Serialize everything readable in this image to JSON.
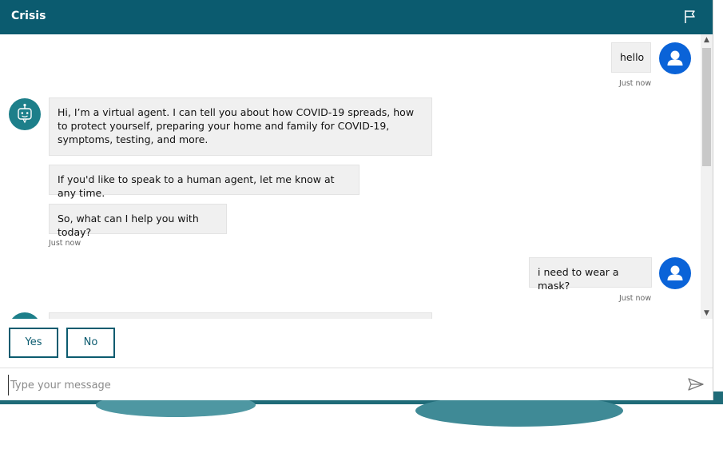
{
  "header": {
    "title": "Crisis",
    "icon": "flag-icon"
  },
  "messages": [
    {
      "from": "user",
      "text": "hello",
      "time": "Just now"
    },
    {
      "from": "bot",
      "text": "Hi, I’m a virtual agent. I can tell you about how COVID-19 spreads, how to protect yourself, preparing your home and family for COVID-19, symptoms, testing, and more."
    },
    {
      "from": "bot",
      "text": "If you'd like to speak to a human agent, let me know at any time."
    },
    {
      "from": "bot",
      "text": "So, what can I help you with today?",
      "time": "Just now"
    },
    {
      "from": "user",
      "text": "i need to wear a mask?",
      "time": "Just now"
    }
  ],
  "suggested_actions": [
    {
      "label": "Yes"
    },
    {
      "label": "No"
    }
  ],
  "input": {
    "placeholder": "Type your message",
    "value": ""
  },
  "colors": {
    "header_bg": "#0b5b6f",
    "user_avatar": "#0a63d8",
    "bot_avatar": "#1d7f8a",
    "bubble_bg": "#f0f0f0"
  }
}
